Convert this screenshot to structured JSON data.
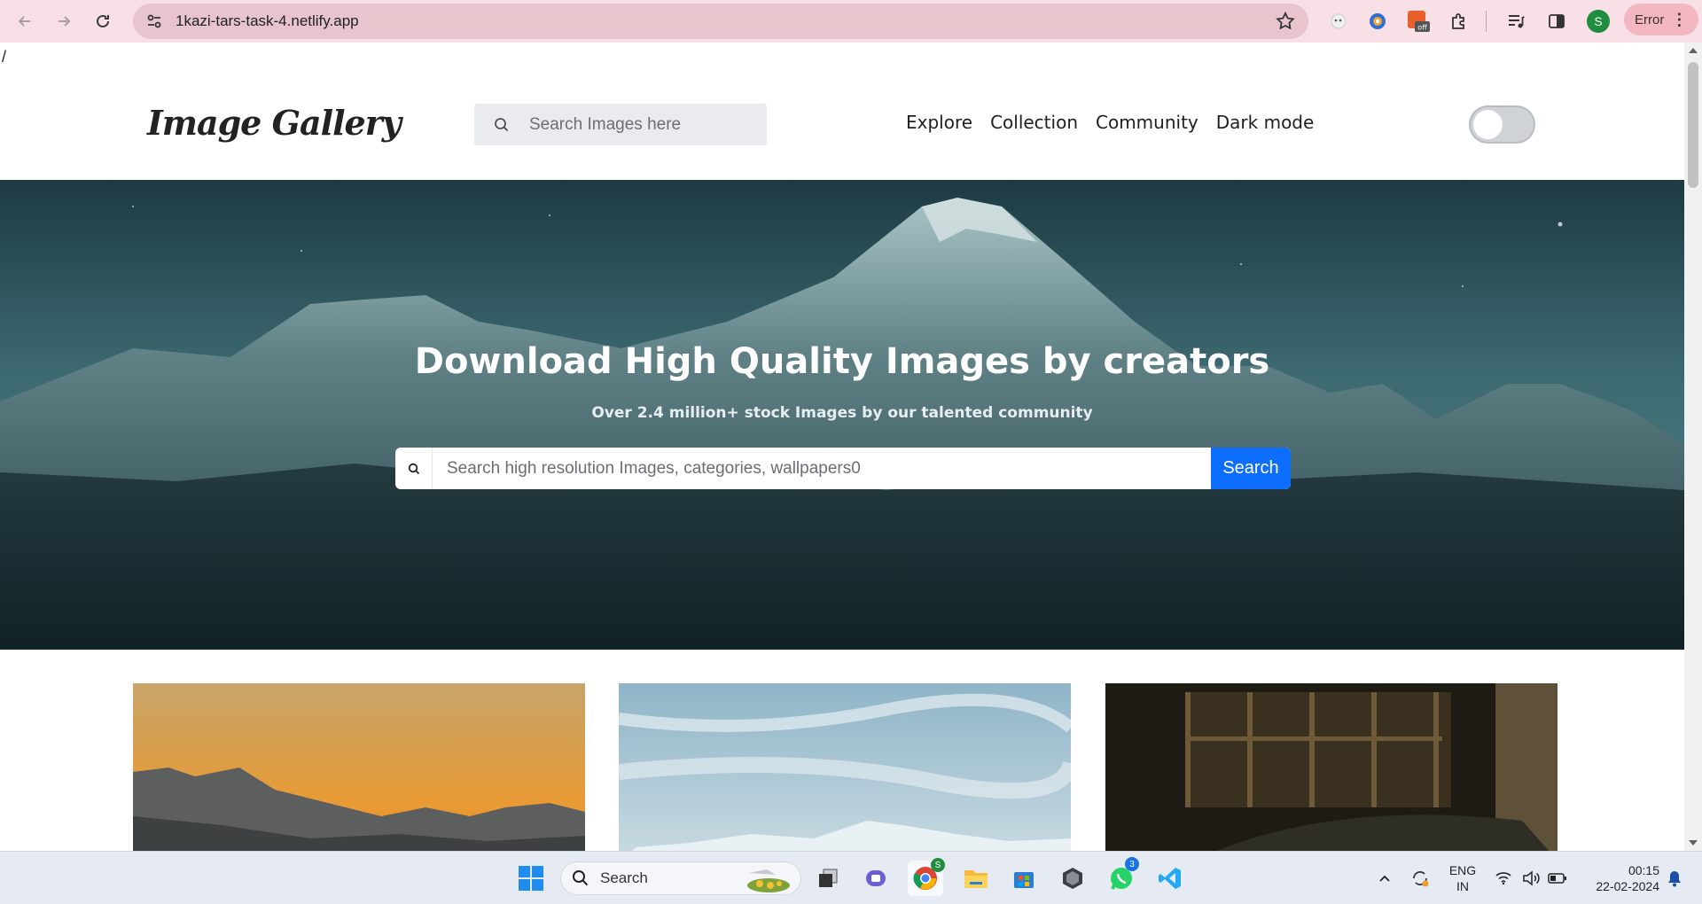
{
  "browser": {
    "url": "1kazi-tars-task-4.netlify.app",
    "error_label": "Error",
    "profile_initial": "S",
    "extension_badge": "off"
  },
  "page": {
    "stray_text": "/",
    "logo": "Image Gallery",
    "header_search_placeholder": "Search Images here",
    "nav": [
      "Explore",
      "Collection",
      "Community",
      "Dark mode"
    ],
    "dark_mode_on": false
  },
  "hero": {
    "title": "Download High Quality Images by creators",
    "subtitle": "Over 2.4 million+ stock Images by our talented community",
    "search_placeholder": "Search high resolution Images, categories, wallpapers0",
    "search_button": "Search"
  },
  "taskbar": {
    "search_label": "Search",
    "chrome_badge": "S",
    "whatsapp_badge": "3",
    "language_line1": "ENG",
    "language_line2": "IN",
    "time": "00:15",
    "date": "22-02-2024"
  },
  "colors": {
    "accent": "#0d6efd",
    "browser_bar": "#f9e0e6",
    "omnibox": "#e8c4cd"
  }
}
